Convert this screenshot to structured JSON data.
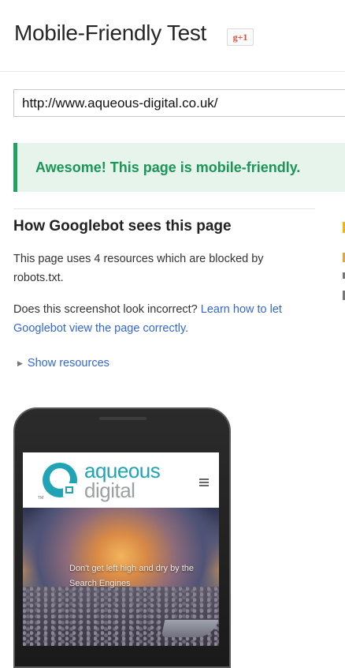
{
  "header": {
    "title": "Mobile-Friendly Test",
    "gplus_label": "g+1"
  },
  "url_input": {
    "value": "http://www.aqueous-digital.co.uk/"
  },
  "result": {
    "message": "Awesome! This page is mobile-friendly.",
    "status_color": "#1b9657"
  },
  "googlebot": {
    "heading": "How Googlebot sees this page",
    "blocked_text": "This page uses 4 resources which are blocked by robots.txt.",
    "question_text": "Does this screenshot look incorrect?",
    "learn_link": "Learn how to let Googlebot view the page correctly.",
    "show_resources": "Show resources"
  },
  "preview": {
    "logo_line1": "aqueous",
    "logo_line2": "digital",
    "trademark": "TM",
    "hero_text": "Don't get left high and dry by the Search Engines",
    "brand_color": "#1fa3b5",
    "menu_icon": "hamburger-icon"
  }
}
